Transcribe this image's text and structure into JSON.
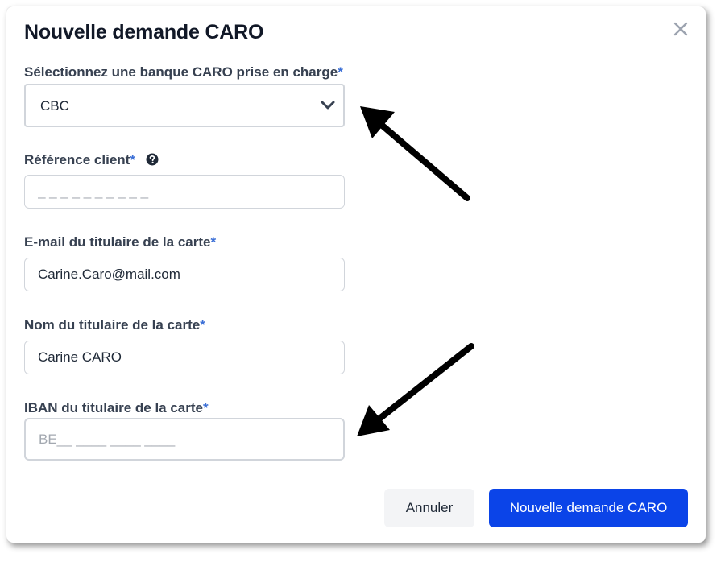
{
  "modal": {
    "title": "Nouvelle demande CARO"
  },
  "form": {
    "bank": {
      "label": "Sélectionnez une banque CARO prise en charge",
      "required_mark": "*",
      "selected_value": "CBC"
    },
    "client_reference": {
      "label": "Référence client",
      "required_mark": "*",
      "placeholder": "_ _ _ _ _ _ _ _ _ _",
      "value": ""
    },
    "email": {
      "label": "E-mail du titulaire de la carte",
      "required_mark": "*",
      "value": "Carine.Caro@mail.com"
    },
    "name": {
      "label": "Nom du titulaire de la carte",
      "required_mark": "*",
      "value": "Carine CARO"
    },
    "iban": {
      "label": "IBAN du titulaire de la carte",
      "required_mark": "*",
      "placeholder": "BE__ ____ ____ ____",
      "value": ""
    }
  },
  "buttons": {
    "cancel_label": "Annuler",
    "submit_label": "Nouvelle demande CARO"
  },
  "icons": {
    "close": "close-icon",
    "dropdown": "chevron-down-icon",
    "help": "question-circle-icon"
  },
  "colors": {
    "primary": "#0b44e8",
    "required_asterisk": "#3b6fd6",
    "annotation_arrow": "#000000"
  }
}
